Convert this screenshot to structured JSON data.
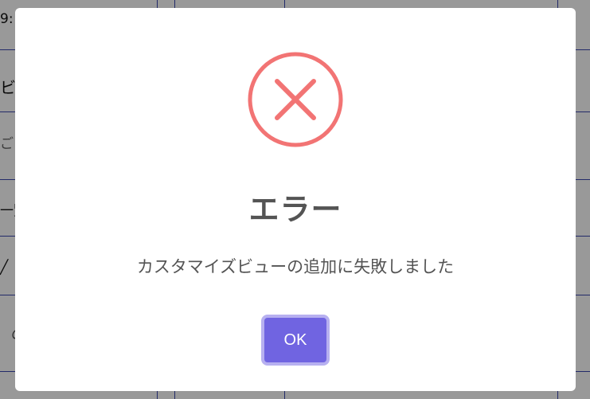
{
  "background": {
    "fragments": [
      "9:",
      "ビ",
      "ご",
      "一覧",
      "╱",
      "の"
    ]
  },
  "dialog": {
    "icon": "error-x-circle-icon",
    "title": "エラー",
    "message": "カスタマイズビューの追加に失敗しました",
    "ok_label": "OK"
  },
  "colors": {
    "error_icon": "#f27474",
    "title_text": "#545454",
    "ok_button": "#7064e1",
    "ok_button_focus_ring": "#b7b0f0",
    "overlay": "rgba(0,0,0,0.4)"
  }
}
